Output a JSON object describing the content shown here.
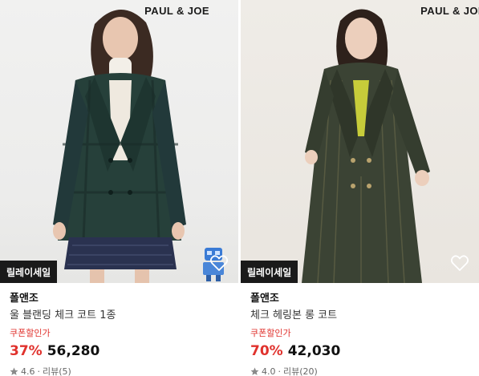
{
  "products": [
    {
      "brand": "폴앤조",
      "title": "울 블랜딩 체크 코트 1종",
      "coupon_label": "쿠폰할인가",
      "discount": "37%",
      "price": "56,280",
      "rating": "4.6",
      "reviews": "리뷰(5)",
      "badge": "릴레이세일",
      "brand_mark": "PAUL & JOE",
      "image_icon": "wishlist-heart-icon"
    },
    {
      "brand": "폴앤조",
      "title": "체크 헤링본 롱 코트",
      "coupon_label": "쿠폰할인가",
      "discount": "70%",
      "price": "42,030",
      "rating": "4.0",
      "reviews": "리뷰(20)",
      "badge": "릴레이세일",
      "brand_mark": "PAUL & JOE",
      "image_icon": "wishlist-heart-icon"
    }
  ],
  "colors": {
    "accent_red": "#e0322d",
    "badge_bg": "#1a1a1a",
    "star": "#8a8a8a"
  }
}
